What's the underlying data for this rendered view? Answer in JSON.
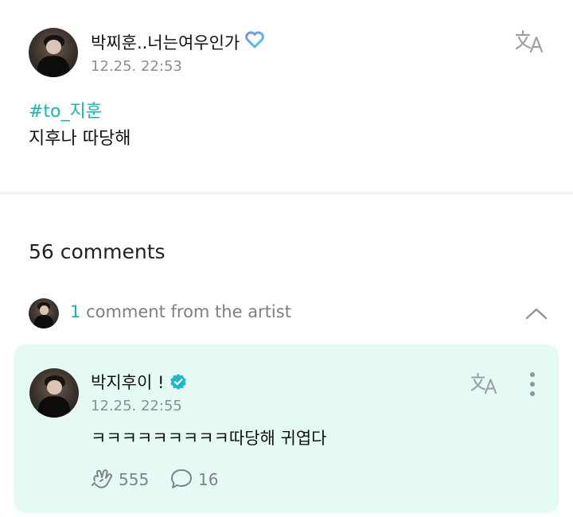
{
  "post": {
    "author": "박찌훈..너는여우인가",
    "timestamp": "12.25. 22:53",
    "hashtag": "#to_지훈",
    "body": "지후나 따당해",
    "translate_icon": "translate-icon"
  },
  "comments": {
    "count_label": "56 comments",
    "artist_count": "1",
    "artist_label": "comment from the artist"
  },
  "artist_comment": {
    "author": "박지후이 !",
    "timestamp": "12.25. 22:55",
    "text": "ㅋㅋㅋㅋㅋㅋㅋㅋㅋ따당해 귀엽다",
    "likes": "555",
    "replies": "16"
  },
  "colors": {
    "accent": "#16b6b0",
    "card_bg": "#e6faf5",
    "verified": "#1fb6c9",
    "muted": "#8a8f94"
  }
}
